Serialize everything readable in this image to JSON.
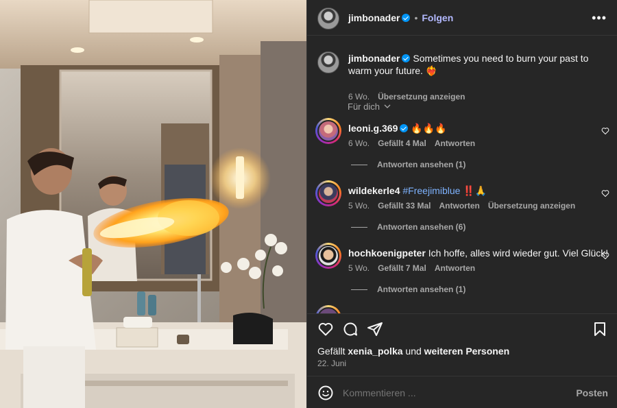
{
  "header": {
    "username": "jimbonader",
    "follow_label": "Folgen",
    "separator": "•",
    "more_label": "•••"
  },
  "caption": {
    "username": "jimbonader",
    "text": "Sometimes you need to burn your past to warm your future. ❤️‍🔥",
    "time": "6 Wo.",
    "translate_label": "Übersetzung anzeigen"
  },
  "filter_label": "Für dich",
  "comments": [
    {
      "username": "leoni.g.369",
      "verified": true,
      "text": "🔥🔥🔥",
      "time": "6 Wo.",
      "likes": "Gefällt 4 Mal",
      "reply_label": "Antworten",
      "view_replies": "Antworten ansehen (1)"
    },
    {
      "username": "wildekerle4",
      "hashtag": "#Freejimiblue",
      "text": " ‼️🙏",
      "time": "5 Wo.",
      "likes": "Gefällt 33 Mal",
      "reply_label": "Antworten",
      "translate_label": "Übersetzung anzeigen",
      "view_replies": "Antworten ansehen (6)"
    },
    {
      "username": "hochkoenigpeter",
      "text": "Ich hoffe, alles wird wieder gut. Viel Glück!",
      "time": "5 Wo.",
      "likes": "Gefällt 7 Mal",
      "reply_label": "Antworten",
      "view_replies": "Antworten ansehen (1)"
    }
  ],
  "likes_line": {
    "prefix": "Gefällt ",
    "user": "xenia_polka",
    "middle": " und ",
    "others": "weiteren Personen"
  },
  "date": "22. Juni",
  "comment_box": {
    "placeholder": "Kommentieren ...",
    "post_label": "Posten"
  },
  "icons": [
    "verified-badge-icon",
    "chevron-down-icon",
    "heart-icon",
    "comment-icon",
    "share-icon",
    "bookmark-icon",
    "emoji-icon",
    "more-icon"
  ]
}
